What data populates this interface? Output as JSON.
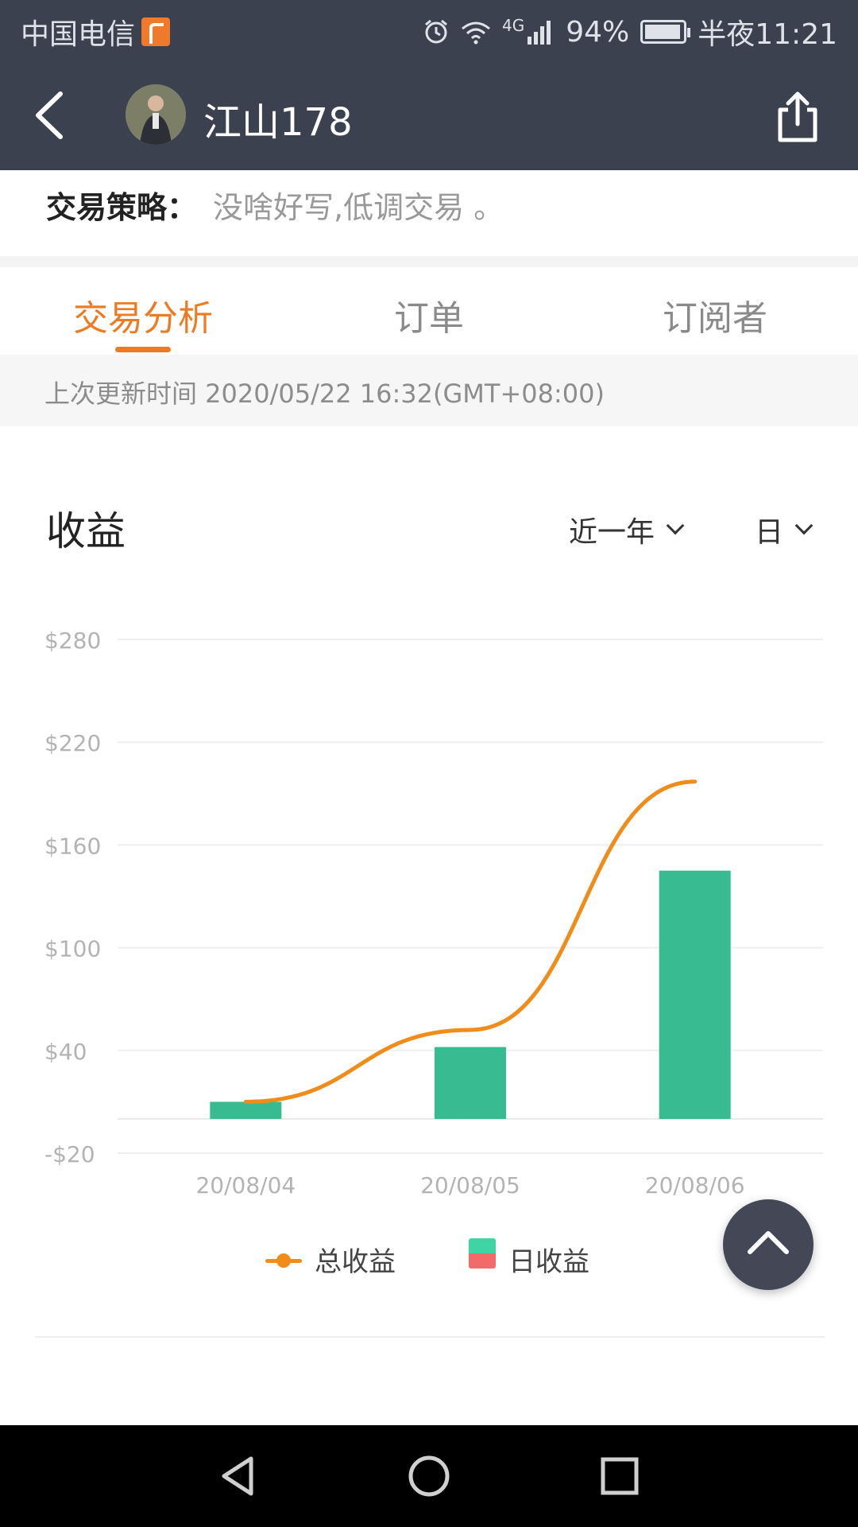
{
  "status_bar": {
    "carrier": "中国电信",
    "network": "4G",
    "battery": "94%",
    "time": "半夜11:21",
    "icons": [
      "alarm-icon",
      "wifi-icon",
      "signal-icon",
      "battery-icon"
    ]
  },
  "header": {
    "nickname": "江山178",
    "icons": [
      "back-arrow-icon",
      "avatar",
      "share-icon"
    ]
  },
  "strategy": {
    "label": "交易策略：",
    "value": "没啥好写,低调交易 。"
  },
  "tabs": [
    {
      "label": "交易分析",
      "active": true
    },
    {
      "label": "订单",
      "active": false
    },
    {
      "label": "订阅者",
      "active": false
    }
  ],
  "update_text": "上次更新时间 2020/05/22 16:32(GMT+08:00)",
  "earnings": {
    "title": "收益",
    "range_select": "近一年",
    "granularity_select": "日"
  },
  "legend": {
    "total": "总收益",
    "daily": "日收益"
  },
  "colors": {
    "accent": "#ee7b22",
    "total_line": "#f08c1a",
    "bar_positive": "#38bb91",
    "legend_positive": "#3ed4a4",
    "legend_negative": "#f26a6a",
    "header_bg": "#3b414e"
  },
  "chart_data": {
    "type": "bar",
    "categories": [
      "20/08/04",
      "20/08/05",
      "20/08/06"
    ],
    "series": [
      {
        "name": "日收益",
        "type": "bar",
        "values": [
          10,
          42,
          145
        ]
      },
      {
        "name": "总收益",
        "type": "line",
        "values": [
          10,
          52,
          197
        ]
      }
    ],
    "yticks": [
      "$280",
      "$220",
      "$160",
      "$100",
      "$40",
      "-$20"
    ],
    "ytick_values": [
      280,
      220,
      160,
      100,
      40,
      -20
    ],
    "ylim": [
      -20,
      280
    ],
    "grid": true,
    "legend_position": "bottom"
  }
}
